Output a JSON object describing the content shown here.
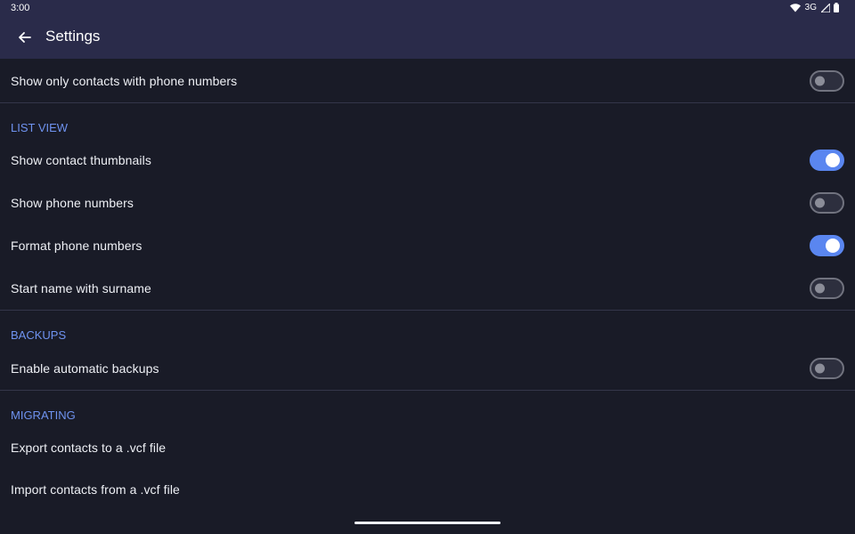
{
  "status_bar": {
    "time": "3:00",
    "network": "3G",
    "icons": [
      "wifi-icon",
      "cellular-signal-icon",
      "battery-icon"
    ]
  },
  "app_bar": {
    "title": "Settings",
    "back_icon": "arrow-back-icon"
  },
  "colors": {
    "app_bar": "#2a2b4a",
    "background": "#191b27",
    "accent": "#6f93f0",
    "switch_on": "#5a86f0",
    "divider": "#34364a"
  },
  "general": {
    "show_only_phone_contacts": {
      "label": "Show only contacts with phone numbers",
      "enabled": false
    }
  },
  "list_view": {
    "title": "LIST VIEW",
    "show_thumbnails": {
      "label": "Show contact thumbnails",
      "enabled": true
    },
    "show_phone_numbers": {
      "label": "Show phone numbers",
      "enabled": false
    },
    "format_phone_numbers": {
      "label": "Format phone numbers",
      "enabled": true
    },
    "start_with_surname": {
      "label": "Start name with surname",
      "enabled": false
    }
  },
  "backups": {
    "title": "BACKUPS",
    "automatic_backups": {
      "label": "Enable automatic backups",
      "enabled": false
    }
  },
  "migrating": {
    "title": "MIGRATING",
    "export_label": "Export contacts to a .vcf file",
    "import_label": "Import contacts from a .vcf file"
  }
}
